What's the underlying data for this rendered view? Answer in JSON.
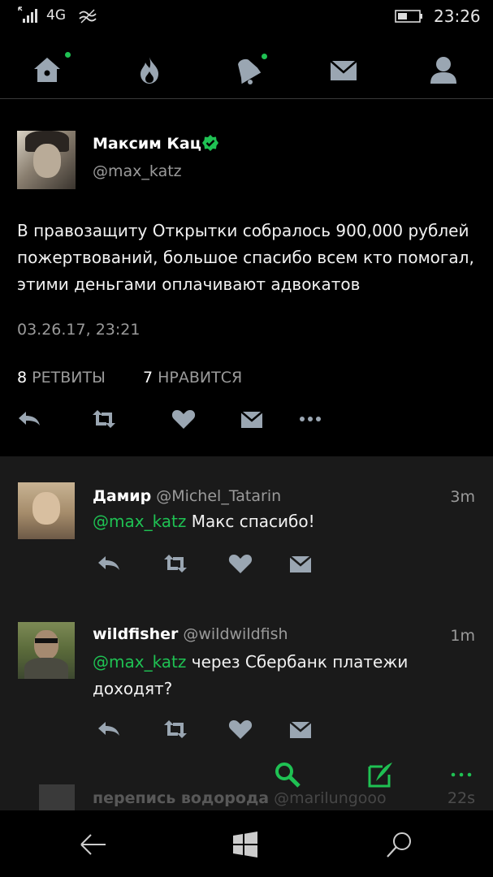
{
  "status_bar": {
    "network": "4G",
    "time": "23:26",
    "icons": [
      "signal-icon",
      "wifi-icon",
      "battery-icon"
    ]
  },
  "nav": {
    "items": [
      {
        "name": "home",
        "icon": "home-icon",
        "has_dot": true
      },
      {
        "name": "trending",
        "icon": "flame-icon",
        "has_dot": false
      },
      {
        "name": "notifications",
        "icon": "bell-icon",
        "has_dot": true
      },
      {
        "name": "messages",
        "icon": "mail-icon",
        "has_dot": false
      },
      {
        "name": "profile",
        "icon": "person-icon",
        "has_dot": false
      }
    ],
    "accent_color": "#1fc153"
  },
  "tweet": {
    "author_name": "Максим Кац",
    "verified": true,
    "handle": "@max_katz",
    "text": "В правозащиту Открытки собралось 900,000 рублей пожертвований, большое спасибо всем кто помогал, этими деньгами оплачивают адвокатов",
    "timestamp": "03.26.17, 23:21",
    "retweets_count": "8",
    "retweets_label": "РЕТВИТЫ",
    "likes_count": "7",
    "likes_label": "НРАВИТСЯ"
  },
  "replies": [
    {
      "name": "Дамир",
      "handle": "@Michel_Tatarin",
      "ago": "3m",
      "mention": "@max_katz",
      "text": " Макс спасибо!"
    },
    {
      "name": "wildfisher",
      "handle": "@wildwildfish",
      "ago": "1m",
      "mention": "@max_katz",
      "text": " через Сбербанк платежи доходят?"
    }
  ],
  "ghost_reply": {
    "name": "перепись водорода",
    "handle": "@marilungooo",
    "ago": "22s"
  },
  "app_bar": {
    "icons": [
      "search-icon",
      "compose-icon",
      "more-icon"
    ]
  },
  "system_nav": {
    "icons": [
      "back-icon",
      "windows-icon",
      "search-icon"
    ]
  },
  "colors": {
    "background": "#000000",
    "reply_background": "#1a1a1a",
    "accent": "#1fc153",
    "muted_text": "#9a9a9a"
  }
}
